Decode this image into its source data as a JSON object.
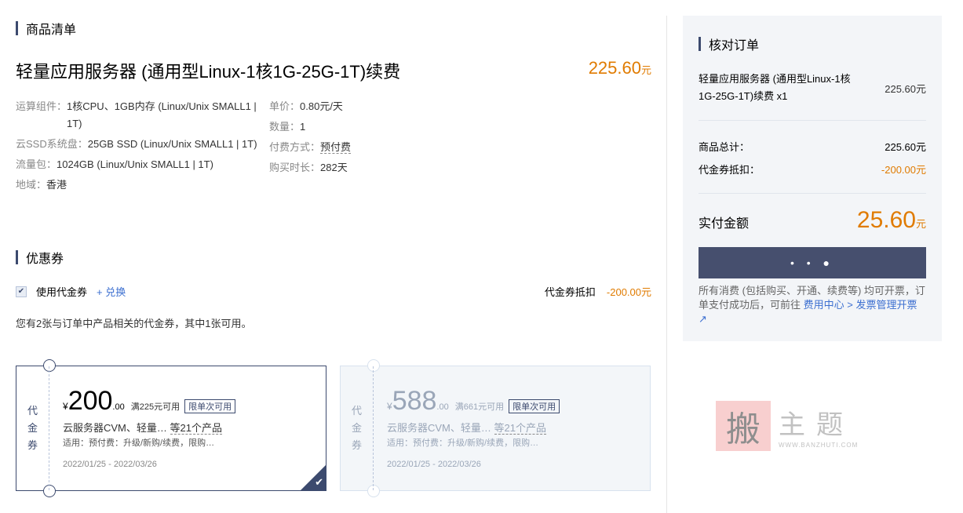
{
  "product_list": {
    "title": "商品清单",
    "name": "轻量应用服务器 (通用型Linux-1核1G-25G-1T)续费",
    "price": "225.60",
    "price_unit": "元",
    "specs_left": [
      {
        "key": "运算组件：",
        "value": "1核CPU、1GB内存 (Linux/Unix SMALL1 | 1T)"
      },
      {
        "key": "云SSD系统盘：",
        "value": "25GB SSD (Linux/Unix SMALL1 | 1T)"
      },
      {
        "key": "流量包：",
        "value": "1024GB (Linux/Unix SMALL1 | 1T)"
      },
      {
        "key": "地域：",
        "value": "香港"
      }
    ],
    "specs_right": [
      {
        "key": "单价：",
        "value": "0.80元/天"
      },
      {
        "key": "数量：",
        "value": "1"
      },
      {
        "key": "付费方式：",
        "value": "预付费"
      },
      {
        "key": "购买时长：",
        "value": "282天"
      }
    ]
  },
  "coupons": {
    "title": "优惠券",
    "use_label": "使用代金券",
    "redeem_label": "+ 兑换",
    "deduct_label": "代金券抵扣",
    "deduct_value": "-200.00元",
    "notice": "您有2张与订单中产品相关的代金券，其中1张可用。",
    "cards": [
      {
        "stub": [
          "代",
          "金",
          "券"
        ],
        "symbol": "¥",
        "amount": "200",
        "decimal": ".00",
        "condition": "满225元可用",
        "tag": "限单次可用",
        "products": "云服务器CVM、轻量…",
        "products_more": "等21个产品",
        "apply": "适用：预付费：升级/新购/续费，限购…",
        "date": "2022/01/25 - 2022/03/26",
        "selected": true
      },
      {
        "stub": [
          "代",
          "金",
          "券"
        ],
        "symbol": "¥",
        "amount": "588",
        "decimal": ".00",
        "condition": "满661元可用",
        "tag": "限单次可用",
        "products": "云服务器CVM、轻量…",
        "products_more": "等21个产品",
        "apply": "适用：预付费：升级/新购/续费，限购…",
        "date": "2022/01/25 - 2022/03/26",
        "selected": false
      }
    ]
  },
  "order_summary": {
    "title": "核对订单",
    "item_name": "轻量应用服务器 (通用型Linux-1核1G-25G-1T)续费 x1",
    "item_price": "225.60元",
    "total_label": "商品总计：",
    "total_value": "225.60元",
    "coupon_label": "代金券抵扣：",
    "coupon_value": "-200.00元",
    "pay_label": "实付金额",
    "pay_amount": "25.60",
    "pay_unit": "元",
    "button_label": "• • ●",
    "note_text": "所有消费 (包括购买、开通、续费等) 均可开票，订单支付成功后，可前往 ",
    "note_link": "费用中心 > 发票管理开票 ↗"
  },
  "watermark": {
    "seal_char": "搬",
    "text": "主题",
    "url": "WWW.BANZHUTI.COM"
  },
  "colors": {
    "accent": "#e07b00",
    "primary": "#3c4a6e",
    "link": "#3c6fd0"
  }
}
